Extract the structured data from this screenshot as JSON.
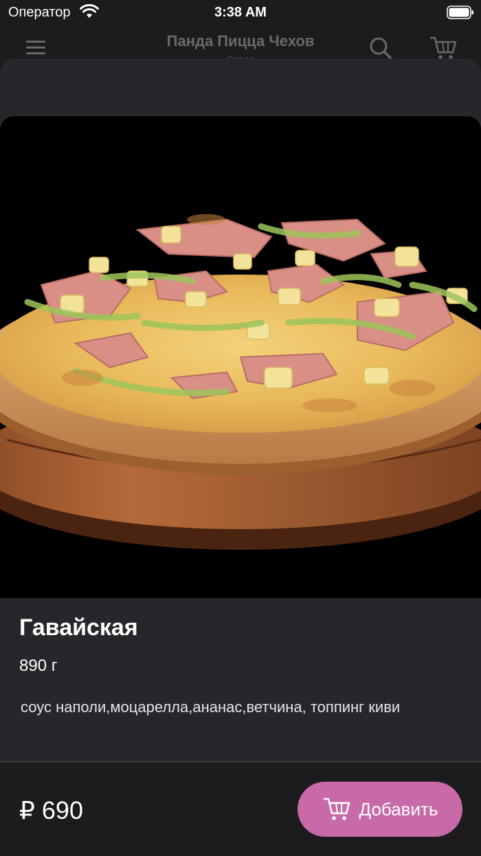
{
  "status_bar": {
    "carrier": "Оператор",
    "time": "3:38 AM",
    "wifi_icon": "wifi-icon",
    "battery_icon": "battery-icon"
  },
  "nav": {
    "title": "Панда Пицца Чехов",
    "subtitle": "Около",
    "menu_icon": "menu-icon",
    "search_icon": "search-icon",
    "cart_icon": "cart-icon"
  },
  "product": {
    "image_alt": "pizza-photo",
    "name": "Гавайская",
    "weight": "890 г",
    "description": "соус наполи,моцарелла,ананас,ветчина, топпинг киви",
    "price": "₽ 690"
  },
  "actions": {
    "add_label": "Добавить",
    "add_icon": "cart-icon"
  },
  "colors": {
    "accent": "#c96aa8",
    "sheet_background": "#26272b",
    "bottom_bar": "#1c1c1e"
  }
}
